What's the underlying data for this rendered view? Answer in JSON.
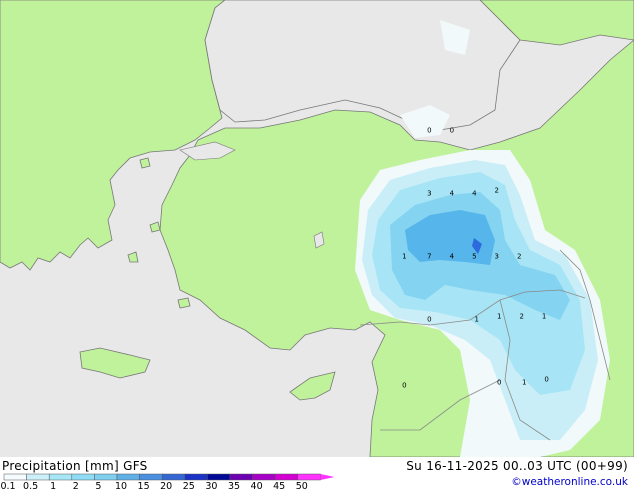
{
  "header": {
    "title": "Precipitation [mm]",
    "model": "GFS",
    "run": "Su 16-11-2025 00..03 UTC (00+99)"
  },
  "credit": "©weatheronline.co.uk",
  "legend": {
    "ticks": [
      "0.1",
      "0.5",
      "1",
      "2",
      "5",
      "10",
      "15",
      "20",
      "25",
      "30",
      "35",
      "40",
      "45",
      "50"
    ],
    "colors": [
      "#f5fbff",
      "#cdeffa",
      "#a6e6f7",
      "#8fdcf5",
      "#7fcfee",
      "#60b0e8",
      "#4a8fe0",
      "#3467d4",
      "#1a32c6",
      "#000a96",
      "#6e00b4",
      "#a800c8",
      "#d200d2",
      "#ff32ff"
    ]
  },
  "map": {
    "land_color": "#bff29a",
    "sea_color": "#e8e8e8",
    "border_color": "#8a8a8a",
    "precip_levels": [
      "#f2f9fb",
      "#c9eef7",
      "#a7e5f6",
      "#84d3f0",
      "#56b5ea",
      "#2b6bdc"
    ],
    "labels": [
      {
        "text": "0",
        "lon": 37.1,
        "lat": 41.8
      },
      {
        "text": "0",
        "lon": 38.0,
        "lat": 41.8
      },
      {
        "text": "3",
        "lon": 37.1,
        "lat": 39.8
      },
      {
        "text": "4",
        "lon": 38.0,
        "lat": 39.8
      },
      {
        "text": "4",
        "lon": 38.9,
        "lat": 39.8
      },
      {
        "text": "2",
        "lon": 39.8,
        "lat": 39.9
      },
      {
        "text": "1",
        "lon": 36.1,
        "lat": 37.8
      },
      {
        "text": "7",
        "lon": 37.1,
        "lat": 37.8
      },
      {
        "text": "4",
        "lon": 38.0,
        "lat": 37.8
      },
      {
        "text": "5",
        "lon": 38.9,
        "lat": 37.8
      },
      {
        "text": "3",
        "lon": 39.8,
        "lat": 37.8
      },
      {
        "text": "2",
        "lon": 40.7,
        "lat": 37.8
      },
      {
        "text": "0",
        "lon": 37.1,
        "lat": 35.8
      },
      {
        "text": "1",
        "lon": 39.0,
        "lat": 35.8
      },
      {
        "text": "1",
        "lon": 39.9,
        "lat": 35.9
      },
      {
        "text": "2",
        "lon": 40.8,
        "lat": 35.9
      },
      {
        "text": "1",
        "lon": 41.7,
        "lat": 35.9
      },
      {
        "text": "0",
        "lon": 36.1,
        "lat": 33.7
      },
      {
        "text": "0",
        "lon": 39.9,
        "lat": 33.8
      },
      {
        "text": "1",
        "lon": 40.9,
        "lat": 33.8
      },
      {
        "text": "0",
        "lon": 41.8,
        "lat": 33.9
      }
    ]
  }
}
